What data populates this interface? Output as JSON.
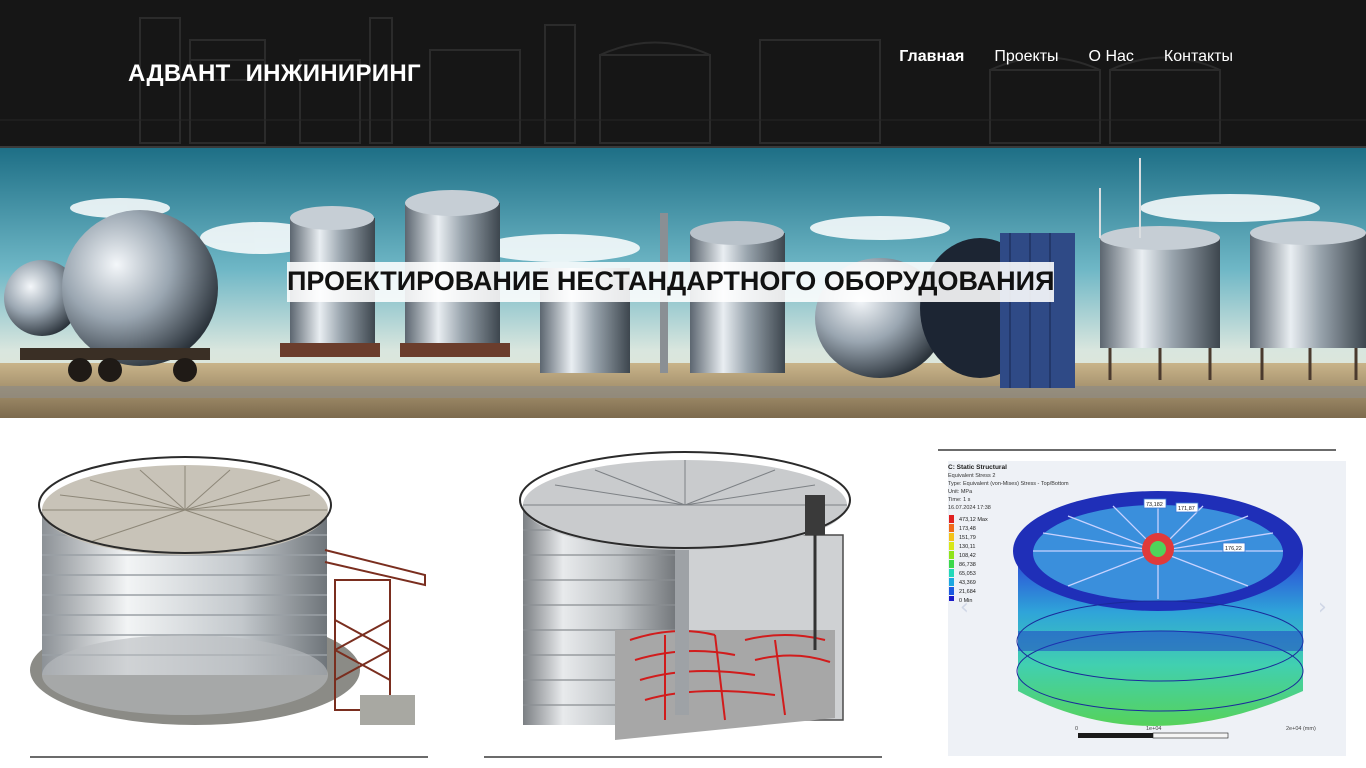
{
  "header": {
    "logo_part1": "АДВАНТ",
    "logo_part2": "ИНЖИНИРИНГ",
    "nav": [
      {
        "label": "Главная",
        "active": true
      },
      {
        "label": "Проекты",
        "active": false
      },
      {
        "label": "О Нас",
        "active": false
      },
      {
        "label": "Контакты",
        "active": false
      }
    ]
  },
  "hero": {
    "title": "ПРОЕКТИРОВАНИЕ НЕСТАНДАРТНОГО ОБОРУДОВАНИЯ"
  },
  "gallery": {
    "sim_title": "C: Static Structural",
    "sim_lines": [
      "Equivalent Stress 2",
      "Type: Equivalent (von-Mises) Stress - Top/Bottom",
      "Unit: MPa",
      "Time: 1 s",
      "16.07.2024 17:38"
    ],
    "legend": [
      "473,12 Max",
      "173,48",
      "151,79",
      "130,11",
      "108,42",
      "86,738",
      "65,053",
      "43,369",
      "21,684",
      "0 Min"
    ],
    "probes": [
      "73,182",
      "171,87",
      "176,22"
    ],
    "scale_label": "2e+04 (mm)",
    "scale_ticks": [
      "0",
      "1e+04"
    ],
    "arrows": {
      "prev": "‹",
      "next": "›"
    }
  },
  "colors": {
    "header_bg": "#161616",
    "text_light": "#ffffff",
    "rule": "#6b6b6b"
  }
}
